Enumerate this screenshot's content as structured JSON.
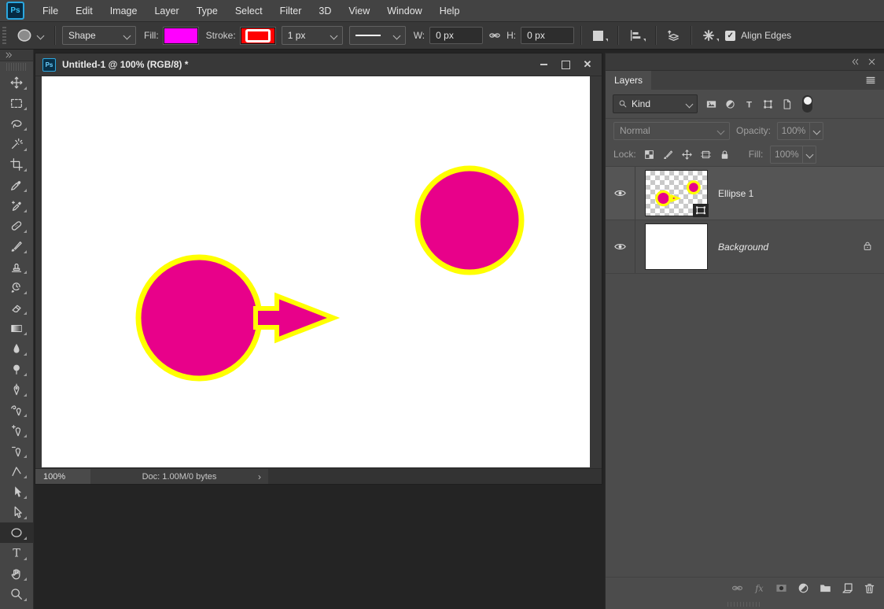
{
  "app": {
    "logo": "Ps"
  },
  "menu": {
    "items": [
      "File",
      "Edit",
      "Image",
      "Layer",
      "Type",
      "Select",
      "Filter",
      "3D",
      "View",
      "Window",
      "Help"
    ]
  },
  "options_bar": {
    "tool_preset_icon": "ellipse",
    "mode": "Shape",
    "fill_label": "Fill:",
    "fill_swatch_color": "#ff00ff",
    "stroke_label": "Stroke:",
    "stroke_swatch_color": "#ff0000",
    "stroke_width": "1 px",
    "w_label": "W:",
    "w_value": "0 px",
    "h_label": "H:",
    "h_value": "0 px",
    "align_edges_label": "Align Edges",
    "align_edges_checked": true,
    "icons": [
      "wh-link",
      "path-operations",
      "align",
      "arrange-3d",
      "gear"
    ]
  },
  "toolbar": {
    "tools": [
      {
        "id": "move-tool",
        "icon": "move"
      },
      {
        "id": "rectangular-marquee-tool",
        "icon": "marquee"
      },
      {
        "id": "lasso-tool",
        "icon": "lasso"
      },
      {
        "id": "magic-wand-tool",
        "icon": "wand"
      },
      {
        "id": "crop-tool",
        "icon": "crop"
      },
      {
        "id": "eyedropper-tool",
        "icon": "eyedropper"
      },
      {
        "id": "spot-healing-brush-tool",
        "icon": "spot-heal"
      },
      {
        "id": "healing-brush-tool",
        "icon": "bandage"
      },
      {
        "id": "brush-tool",
        "icon": "brush"
      },
      {
        "id": "clone-stamp-tool",
        "icon": "stamp"
      },
      {
        "id": "history-brush-tool",
        "icon": "history-brush"
      },
      {
        "id": "eraser-tool",
        "icon": "eraser"
      },
      {
        "id": "gradient-tool",
        "icon": "gradient"
      },
      {
        "id": "blur-tool",
        "icon": "blur"
      },
      {
        "id": "dodge-tool",
        "icon": "dodge"
      },
      {
        "id": "pen-tool",
        "icon": "pen"
      },
      {
        "id": "freeform-pen-tool",
        "icon": "freeform-pen"
      },
      {
        "id": "add-anchor-point-tool",
        "icon": "add-anchor"
      },
      {
        "id": "delete-anchor-point-tool",
        "icon": "delete-anchor"
      },
      {
        "id": "convert-point-tool",
        "icon": "convert-point"
      },
      {
        "id": "path-selection-tool",
        "icon": "path-select"
      },
      {
        "id": "direct-selection-tool",
        "icon": "direct-select"
      },
      {
        "id": "ellipse-tool",
        "icon": "ellipse",
        "selected": true
      },
      {
        "id": "type-tool",
        "icon": "type"
      },
      {
        "id": "hand-tool",
        "icon": "hand"
      },
      {
        "id": "zoom-tool",
        "icon": "zoom"
      }
    ]
  },
  "document": {
    "icon": "Ps",
    "title": "Untitled-1 @ 100% (RGB/8) *",
    "zoom": "100%",
    "doc_info": "Doc: 1.00M/0 bytes",
    "status_chevron": "›",
    "window_icons": [
      "minimize",
      "maximize",
      "close"
    ],
    "shapes": {
      "fill": "#e8018a",
      "stroke": "#ffff00"
    }
  },
  "layers_panel": {
    "header_icons": [
      "collapse",
      "close"
    ],
    "tab": "Layers",
    "menu_icon": "hamburger",
    "kind_label": "Kind",
    "filter_icons": [
      {
        "id": "filter-image-icon",
        "icon": "image"
      },
      {
        "id": "filter-adjustment-icon",
        "icon": "adjust"
      },
      {
        "id": "filter-type-icon",
        "icon": "type-small"
      },
      {
        "id": "filter-shape-icon",
        "icon": "shape-corners"
      },
      {
        "id": "filter-smart-object-icon",
        "icon": "page"
      }
    ],
    "blend_mode": "Normal",
    "opacity_label": "Opacity:",
    "opacity_value": "100%",
    "lock_label": "Lock:",
    "lock_icons": [
      {
        "id": "lock-transparency-icon",
        "icon": "checker"
      },
      {
        "id": "lock-pixels-icon",
        "icon": "brush"
      },
      {
        "id": "lock-position-icon",
        "icon": "move"
      },
      {
        "id": "lock-artboard-icon",
        "icon": "artboard"
      },
      {
        "id": "lock-all-icon",
        "icon": "lock"
      }
    ],
    "fill_label": "Fill:",
    "fill_value": "100%",
    "layers": [
      {
        "name": "Ellipse 1",
        "selected": true,
        "visible": true,
        "badge": "vector-mask"
      },
      {
        "name": "Background",
        "visible": true,
        "locked": true
      }
    ],
    "bottom_icons": [
      {
        "id": "link-layers-icon",
        "icon": "link",
        "dim": true
      },
      {
        "id": "layer-style-icon",
        "icon": "fx",
        "dim": true
      },
      {
        "id": "add-mask-icon",
        "icon": "mask"
      },
      {
        "id": "adjustment-layer-icon",
        "icon": "adjust"
      },
      {
        "id": "new-group-icon",
        "icon": "folder"
      },
      {
        "id": "new-layer-icon",
        "icon": "new-layer"
      },
      {
        "id": "delete-layer-icon",
        "icon": "trash"
      }
    ]
  }
}
